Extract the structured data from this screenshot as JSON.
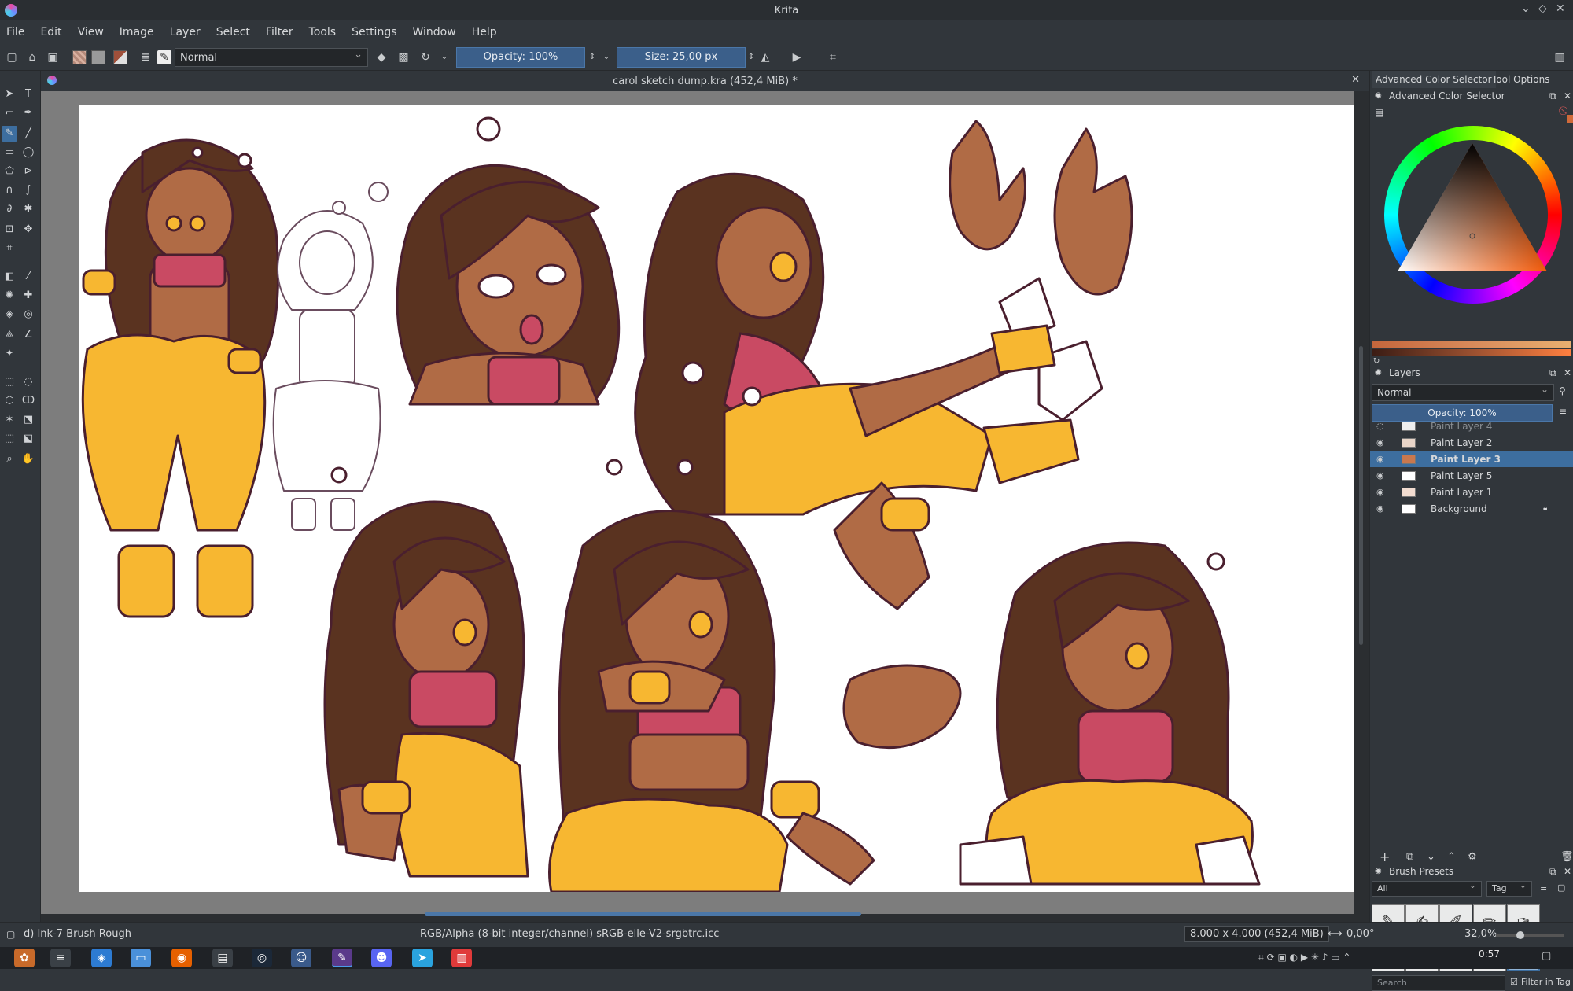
{
  "window": {
    "title": "Krita"
  },
  "menu": [
    "File",
    "Edit",
    "View",
    "Image",
    "Layer",
    "Select",
    "Filter",
    "Tools",
    "Settings",
    "Window",
    "Help"
  ],
  "toolbar": {
    "blend_mode": "Normal",
    "opacity": "Opacity: 100%",
    "size": "Size: 25,00 px"
  },
  "document": {
    "tab_title": "carol sketch dump.kra (452,4 MiB) *"
  },
  "dock": {
    "tabs": [
      "Advanced Color Selector",
      "Tool Options"
    ],
    "color_selector_title": "Advanced Color Selector",
    "layers_title": "Layers",
    "layers_blend": "Normal",
    "layers_opacity": "Opacity: 100%",
    "layers": [
      {
        "name": "Paint Layer 4",
        "state": "hidden"
      },
      {
        "name": "Paint Layer 2",
        "state": "visible"
      },
      {
        "name": "Paint Layer 3",
        "state": "selected"
      },
      {
        "name": "Paint Layer 5",
        "state": "visible"
      },
      {
        "name": "Paint Layer 1",
        "state": "visible"
      },
      {
        "name": "Background",
        "state": "locked"
      }
    ],
    "brush_presets_title": "Brush Presets",
    "brush_filter": "All",
    "brush_tag": "Tag",
    "search_placeholder": "Search",
    "filter_in_tag": "Filter in Tag"
  },
  "status": {
    "brush": "d) Ink-7 Brush Rough",
    "color_info": "RGB/Alpha (8-bit integer/channel)  sRGB-elle-V2-srgbtrc.icc",
    "dimensions": "8.000 x 4.000 (452,4 MiB)",
    "rotation": "0,00°",
    "zoom": "32,0%"
  },
  "taskbar": {
    "clock": "0:57"
  },
  "colors": {
    "skin": "#b06b45",
    "hair": "#5a3320",
    "pants": "#f7b731",
    "top": "#c94a63",
    "outline": "#4a1f2e",
    "accent": "#3d6e9f"
  }
}
